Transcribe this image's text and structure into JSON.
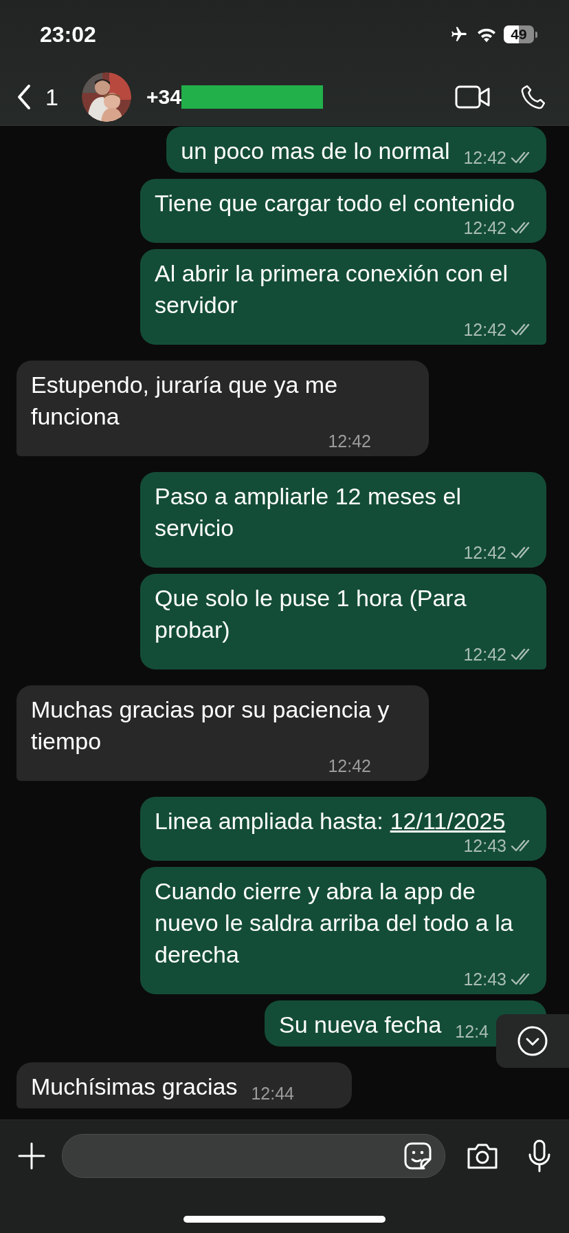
{
  "status_bar": {
    "time": "23:02",
    "battery": "49"
  },
  "header": {
    "back_count": "1",
    "name": "+34",
    "redacted": true
  },
  "messages": [
    {
      "outgoing": true,
      "text": "un poco mas de lo normal",
      "time": "12:42",
      "read": false,
      "tail": false
    },
    {
      "outgoing": true,
      "text": "Tiene que cargar todo el contenido",
      "time": "12:42",
      "read": false,
      "tail": false
    },
    {
      "outgoing": true,
      "text": "Al abrir la primera conexión con el servidor",
      "time": "12:42",
      "read": false,
      "tail": true
    },
    {
      "outgoing": false,
      "text": "Estupendo, juraría que ya me funciona",
      "time": "12:42",
      "tail": true
    },
    {
      "outgoing": true,
      "text": "Paso a ampliarle 12 meses el servicio",
      "time": "12:42",
      "read": false,
      "tail": false
    },
    {
      "outgoing": true,
      "text": "Que solo le puse 1 hora (Para probar)",
      "time": "12:42",
      "read": false,
      "tail": true
    },
    {
      "outgoing": false,
      "text": "Muchas gracias por su paciencia y tiempo",
      "time": "12:42",
      "tail": true
    },
    {
      "outgoing": true,
      "text": "Linea ampliada hasta:",
      "link": "12/11/2025",
      "time": "12:43",
      "read": false,
      "tail": false
    },
    {
      "outgoing": true,
      "text": "Cuando cierre y abra la app de nuevo le saldra arriba del todo a la derecha",
      "time": "12:43",
      "read": false,
      "tail": false
    },
    {
      "outgoing": true,
      "text": "Su nueva fecha",
      "time": "12:4",
      "tail": true
    },
    {
      "outgoing": false,
      "text": "Muchísimas gracias",
      "time": "12:44",
      "tail": true
    }
  ]
}
